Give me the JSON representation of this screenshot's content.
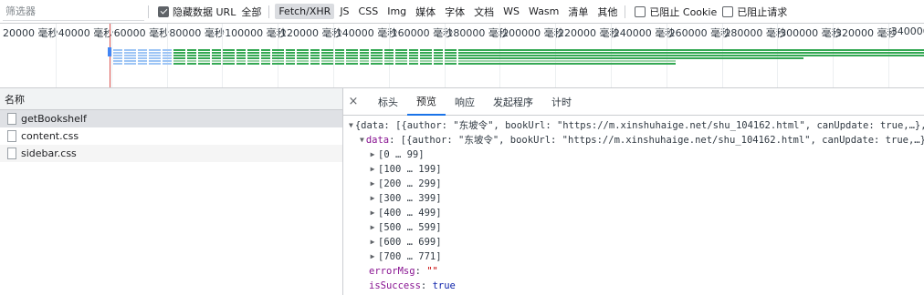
{
  "filter": {
    "placeholder": "筛选器"
  },
  "options": {
    "hide_data_urls": {
      "label": "隐藏数据 URL",
      "checked": true
    },
    "all_label": "全部",
    "types": [
      "Fetch/XHR",
      "JS",
      "CSS",
      "Img",
      "媒体",
      "字体",
      "文档",
      "WS",
      "Wasm",
      "清单",
      "其他"
    ],
    "active_type": "Fetch/XHR",
    "blocked_cookies": {
      "label": "已阻止 Cookie",
      "checked": false
    },
    "blocked_requests": {
      "label": "已阻止请求",
      "checked": false
    }
  },
  "overview": {
    "ticks": [
      "20000 毫秒",
      "40000 毫秒",
      "60000 毫秒",
      "80000 毫秒",
      "100000 毫秒",
      "120000 毫秒",
      "140000 毫秒",
      "160000 毫秒",
      "180000 毫秒",
      "200000 毫秒",
      "220000 毫秒",
      "240000 毫秒",
      "260000 毫秒",
      "280000 毫秒",
      "300000 毫秒",
      "320000 毫秒",
      "340000"
    ]
  },
  "requests": {
    "header": "名称",
    "items": [
      "getBookshelf",
      "content.css",
      "sidebar.css"
    ]
  },
  "detail": {
    "close_label": "×",
    "tabs": [
      "标头",
      "预览",
      "响应",
      "发起程序",
      "计时"
    ],
    "active_tab": "预览",
    "tree": {
      "root": "{data: [{author: \"东坡令\", bookUrl: \"https://m.xinshuhaige.net/shu_104162.html\", canUpdate: true,…},…],…}",
      "data_key": "data",
      "data_summary": "[{author: \"东坡令\", bookUrl: \"https://m.xinshuhaige.net/shu_104162.html\", canUpdate: true,…},…]",
      "ranges": [
        "[0 … 99]",
        "[100 … 199]",
        "[200 … 299]",
        "[300 … 399]",
        "[400 … 499]",
        "[500 … 599]",
        "[600 … 699]",
        "[700 … 771]"
      ],
      "error_key": "errorMsg",
      "error_value": "\"\"",
      "success_key": "isSuccess",
      "success_value": "true"
    }
  }
}
